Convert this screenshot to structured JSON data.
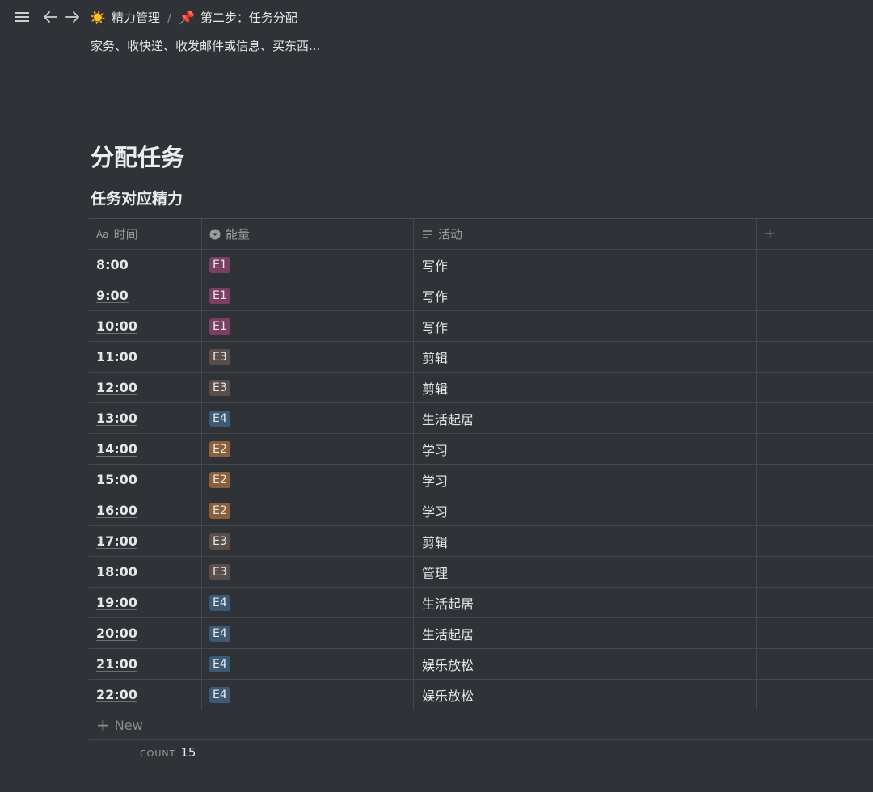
{
  "topbar": {
    "menu_icon": "hamburger-menu-icon",
    "back_icon": "arrow-left-icon",
    "forward_icon": "arrow-right-icon",
    "breadcrumbs": [
      {
        "emoji": "☀️",
        "label": "精力管理"
      },
      {
        "emoji": "📌",
        "label": "第二步：任务分配"
      }
    ],
    "separator": "/"
  },
  "page": {
    "subtext": "家务、收快递、收发邮件或信息、买东西...",
    "title": "分配任务",
    "table_title": "任务对应精力"
  },
  "table": {
    "columns": [
      {
        "label": "时间",
        "icon": "title-property-icon",
        "icon_text": "Aa"
      },
      {
        "label": "能量",
        "icon": "select-property-icon",
        "icon_text": "▾"
      },
      {
        "label": "活动",
        "icon": "text-property-icon",
        "icon_text": "≡"
      }
    ],
    "add_column_label": "+",
    "tag_colors": {
      "E1": "#7a3f62",
      "E2": "#8a5f3a",
      "E3": "#5a4e4a",
      "E4": "#3c5975"
    },
    "rows": [
      {
        "time": "8:00",
        "energy": "E1",
        "activity": "写作"
      },
      {
        "time": "9:00",
        "energy": "E1",
        "activity": "写作"
      },
      {
        "time": "10:00",
        "energy": "E1",
        "activity": "写作"
      },
      {
        "time": "11:00",
        "energy": "E3",
        "activity": "剪辑"
      },
      {
        "time": "12:00",
        "energy": "E3",
        "activity": "剪辑"
      },
      {
        "time": "13:00",
        "energy": "E4",
        "activity": "生活起居"
      },
      {
        "time": "14:00",
        "energy": "E2",
        "activity": "学习"
      },
      {
        "time": "15:00",
        "energy": "E2",
        "activity": "学习"
      },
      {
        "time": "16:00",
        "energy": "E2",
        "activity": "学习"
      },
      {
        "time": "17:00",
        "energy": "E3",
        "activity": "剪辑"
      },
      {
        "time": "18:00",
        "energy": "E3",
        "activity": "管理"
      },
      {
        "time": "19:00",
        "energy": "E4",
        "activity": "生活起居"
      },
      {
        "time": "20:00",
        "energy": "E4",
        "activity": "生活起居"
      },
      {
        "time": "21:00",
        "energy": "E4",
        "activity": "娱乐放松"
      },
      {
        "time": "22:00",
        "energy": "E4",
        "activity": "娱乐放松"
      }
    ],
    "new_label": "New",
    "count_label": "COUNT",
    "count_value": "15"
  }
}
